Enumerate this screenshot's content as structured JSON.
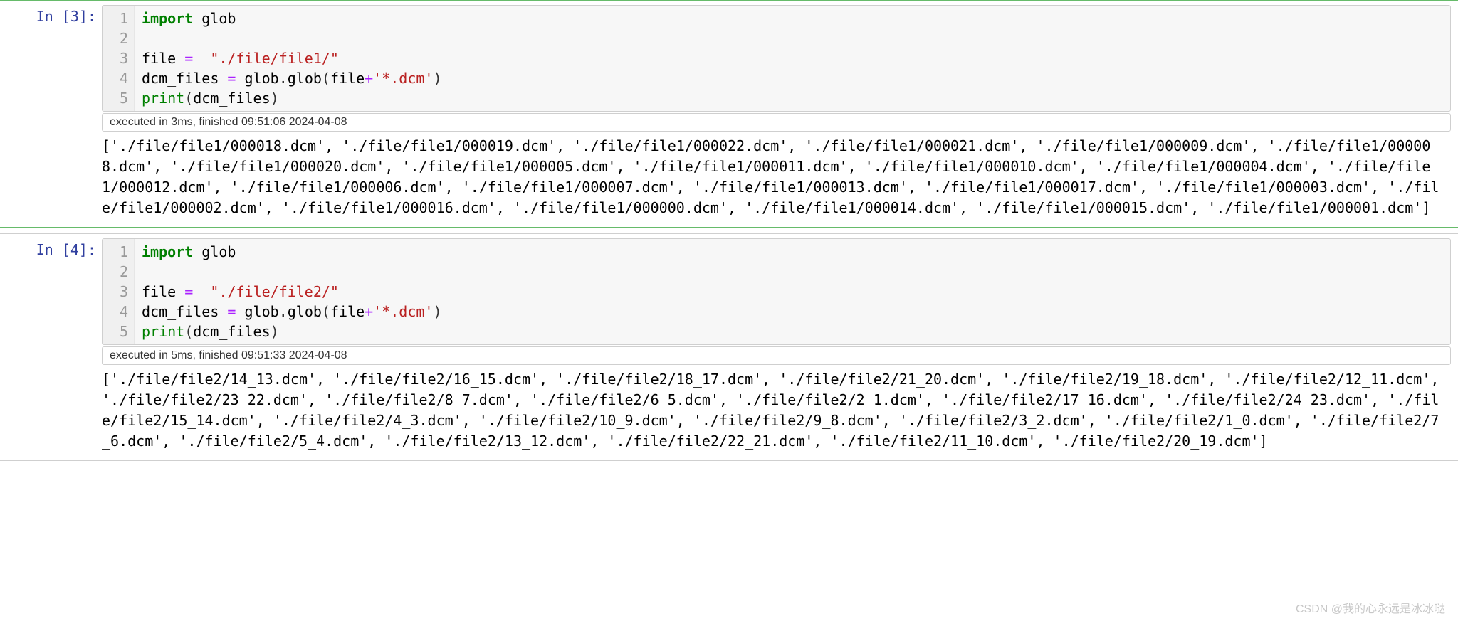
{
  "watermark": "CSDN @我的心永远是冰冰哒",
  "cells": [
    {
      "prompt": "In [3]:",
      "selected": true,
      "lines": [
        "1",
        "2",
        "3",
        "4",
        "5"
      ],
      "code": {
        "l1": {
          "kw": "import",
          "sp": " ",
          "nm": "glob"
        },
        "l3": {
          "nm1": "file",
          "sp1": " ",
          "op1": "=",
          "sp2": "  ",
          "str": "\"./file/file1/\""
        },
        "l4": {
          "nm1": "dcm_files",
          "sp1": " ",
          "op1": "=",
          "sp2": " ",
          "nm2": "glob",
          "dot1": ".",
          "nm3": "glob",
          "p1": "(",
          "nm4": "file",
          "op2": "+",
          "str": "'*.dcm'",
          "p2": ")"
        },
        "l5": {
          "bi": "print",
          "p1": "(",
          "nm": "dcm_files",
          "p2": ")"
        }
      },
      "status": "executed in 3ms, finished 09:51:06 2024-04-08",
      "output": "['./file/file1/000018.dcm', './file/file1/000019.dcm', './file/file1/000022.dcm', './file/file1/000021.dcm', './file/file1/000009.dcm', './file/file1/000008.dcm', './file/file1/000020.dcm', './file/file1/000005.dcm', './file/file1/000011.dcm', './file/file1/000010.dcm', './file/file1/000004.dcm', './file/file1/000012.dcm', './file/file1/000006.dcm', './file/file1/000007.dcm', './file/file1/000013.dcm', './file/file1/000017.dcm', './file/file1/000003.dcm', './file/file1/000002.dcm', './file/file1/000016.dcm', './file/file1/000000.dcm', './file/file1/000014.dcm', './file/file1/000015.dcm', './file/file1/000001.dcm']"
    },
    {
      "prompt": "In [4]:",
      "selected": false,
      "lines": [
        "1",
        "2",
        "3",
        "4",
        "5"
      ],
      "code": {
        "l1": {
          "kw": "import",
          "sp": " ",
          "nm": "glob"
        },
        "l3": {
          "nm1": "file",
          "sp1": " ",
          "op1": "=",
          "sp2": "  ",
          "str": "\"./file/file2/\""
        },
        "l4": {
          "nm1": "dcm_files",
          "sp1": " ",
          "op1": "=",
          "sp2": " ",
          "nm2": "glob",
          "dot1": ".",
          "nm3": "glob",
          "p1": "(",
          "nm4": "file",
          "op2": "+",
          "str": "'*.dcm'",
          "p2": ")"
        },
        "l5": {
          "bi": "print",
          "p1": "(",
          "nm": "dcm_files",
          "p2": ")"
        }
      },
      "status": "executed in 5ms, finished 09:51:33 2024-04-08",
      "output": "['./file/file2/14_13.dcm', './file/file2/16_15.dcm', './file/file2/18_17.dcm', './file/file2/21_20.dcm', './file/file2/19_18.dcm', './file/file2/12_11.dcm', './file/file2/23_22.dcm', './file/file2/8_7.dcm', './file/file2/6_5.dcm', './file/file2/2_1.dcm', './file/file2/17_16.dcm', './file/file2/24_23.dcm', './file/file2/15_14.dcm', './file/file2/4_3.dcm', './file/file2/10_9.dcm', './file/file2/9_8.dcm', './file/file2/3_2.dcm', './file/file2/1_0.dcm', './file/file2/7_6.dcm', './file/file2/5_4.dcm', './file/file2/13_12.dcm', './file/file2/22_21.dcm', './file/file2/11_10.dcm', './file/file2/20_19.dcm']"
    }
  ]
}
